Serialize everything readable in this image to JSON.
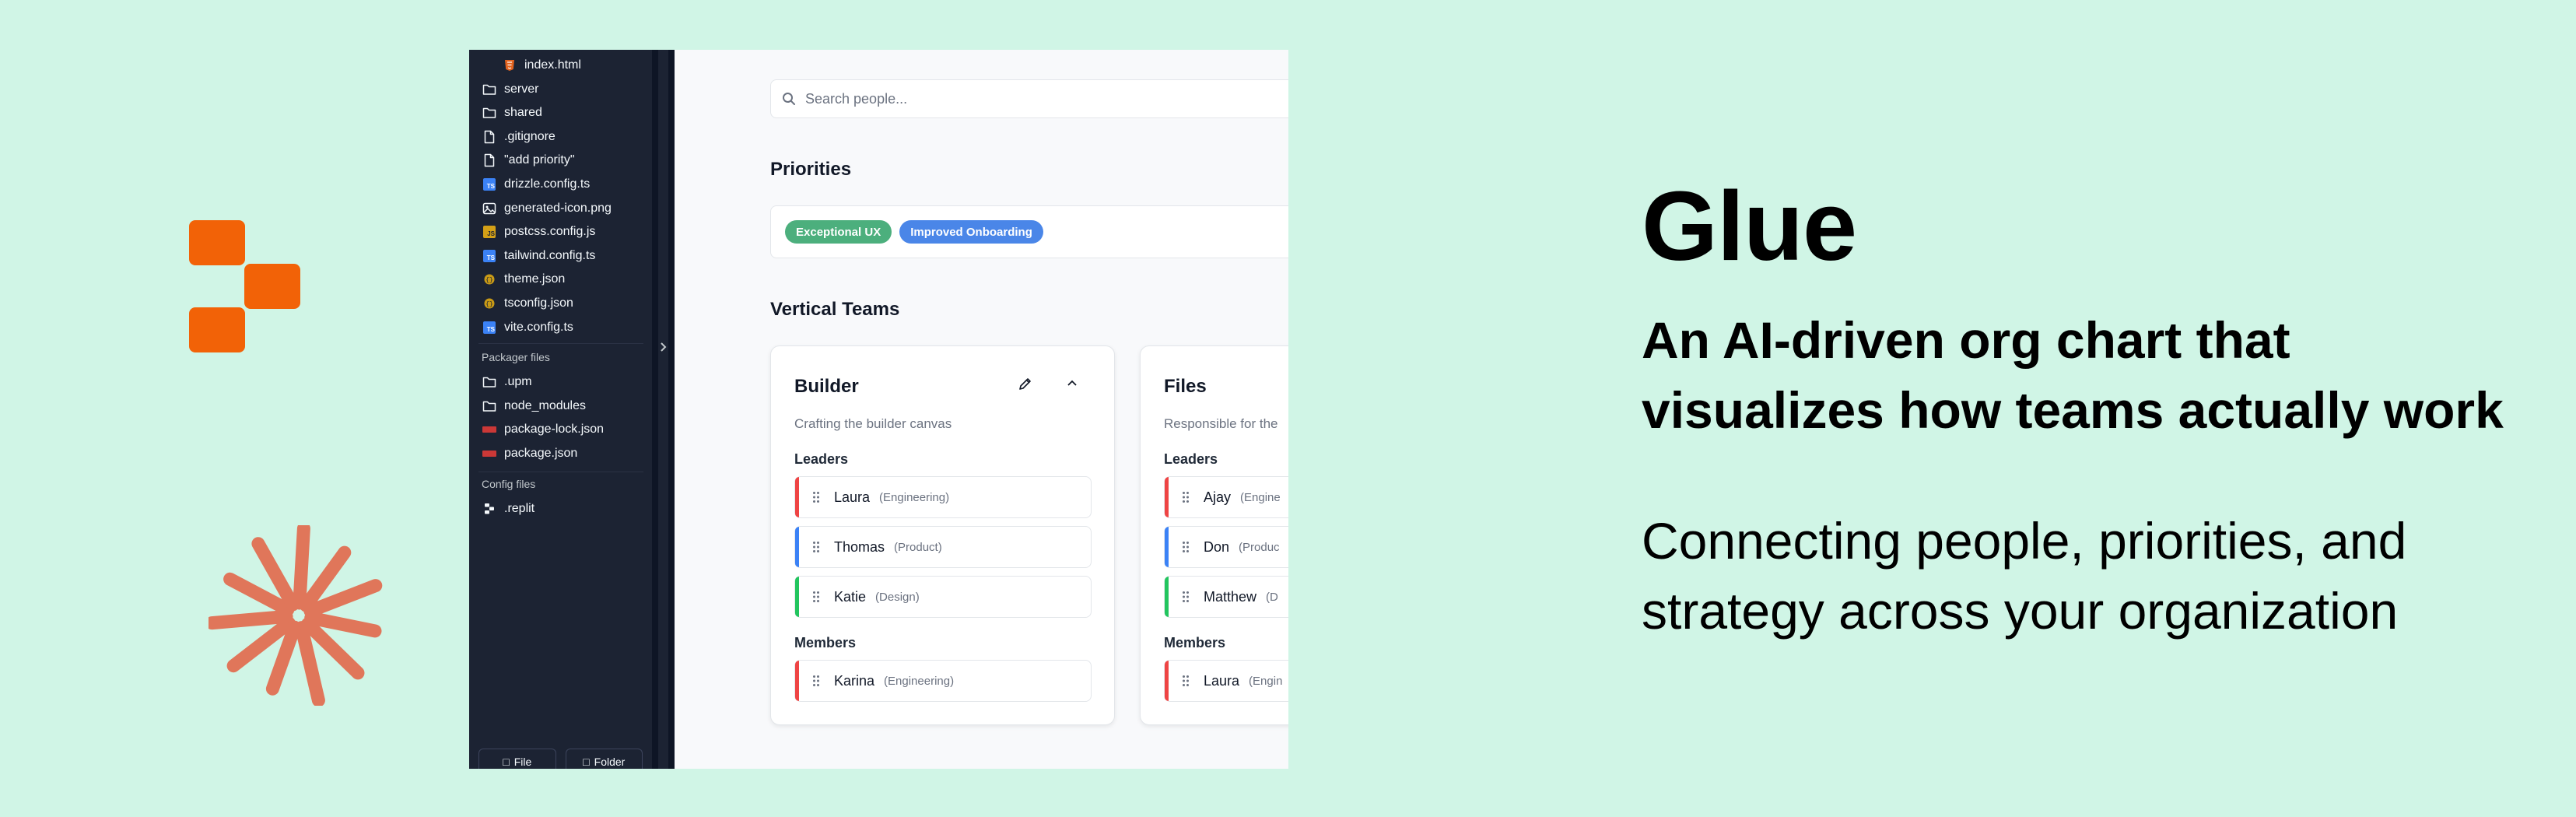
{
  "brand": {
    "accent": "#f26207",
    "burst_color": "#e0765a",
    "background": "#d0f5e6"
  },
  "sidebar": {
    "files": [
      {
        "name": "index.html",
        "icon": "html-file-icon"
      },
      {
        "name": "server",
        "icon": "folder-icon"
      },
      {
        "name": "shared",
        "icon": "folder-icon"
      },
      {
        "name": ".gitignore",
        "icon": "file-icon"
      },
      {
        "name": "\"add priority\"",
        "icon": "file-icon"
      },
      {
        "name": "drizzle.config.ts",
        "icon": "ts-file-icon"
      },
      {
        "name": "generated-icon.png",
        "icon": "image-file-icon"
      },
      {
        "name": "postcss.config.js",
        "icon": "js-file-icon"
      },
      {
        "name": "tailwind.config.ts",
        "icon": "ts-file-icon"
      },
      {
        "name": "theme.json",
        "icon": "json-file-icon"
      },
      {
        "name": "tsconfig.json",
        "icon": "json-file-icon"
      },
      {
        "name": "vite.config.ts",
        "icon": "ts-file-icon"
      }
    ],
    "packager_label": "Packager files",
    "packager_files": [
      {
        "name": ".upm",
        "icon": "folder-icon"
      },
      {
        "name": "node_modules",
        "icon": "folder-icon"
      },
      {
        "name": "package-lock.json",
        "icon": "npm-file-icon"
      },
      {
        "name": "package.json",
        "icon": "npm-file-icon"
      }
    ],
    "config_label": "Config files",
    "config_files": [
      {
        "name": ".replit",
        "icon": "replit-file-icon"
      }
    ],
    "new_file_label": "File",
    "new_folder_label": "Folder"
  },
  "main": {
    "search_placeholder": "Search people...",
    "priorities_heading": "Priorities",
    "priorities": [
      {
        "label": "Exceptional UX",
        "color": "#4caf7d"
      },
      {
        "label": "Improved Onboarding",
        "color": "#4a86e8"
      }
    ],
    "teams_heading": "Vertical Teams",
    "teams": [
      {
        "name": "Builder",
        "description": "Crafting the builder canvas",
        "leaders_label": "Leaders",
        "leaders": [
          {
            "name": "Laura",
            "dept": "(Engineering)",
            "color": "#ef4444"
          },
          {
            "name": "Thomas",
            "dept": "(Product)",
            "color": "#3b82f6"
          },
          {
            "name": "Katie",
            "dept": "(Design)",
            "color": "#22c55e"
          }
        ],
        "members_label": "Members",
        "members": [
          {
            "name": "Karina",
            "dept": "(Engineering)",
            "color": "#ef4444"
          }
        ]
      },
      {
        "name": "Files",
        "description": "Responsible for the",
        "leaders_label": "Leaders",
        "leaders": [
          {
            "name": "Ajay",
            "dept": "(Engine",
            "color": "#ef4444"
          },
          {
            "name": "Don",
            "dept": "(Produc",
            "color": "#3b82f6"
          },
          {
            "name": "Matthew",
            "dept": "(D",
            "color": "#22c55e"
          }
        ],
        "members_label": "Members",
        "members": [
          {
            "name": "Laura",
            "dept": "(Engin",
            "color": "#ef4444"
          }
        ]
      }
    ]
  },
  "hero": {
    "title": "Glue",
    "subtitle": "An AI-driven org chart that visualizes how teams actually work",
    "description": "Connecting people, priorities, and strategy across your organization"
  }
}
